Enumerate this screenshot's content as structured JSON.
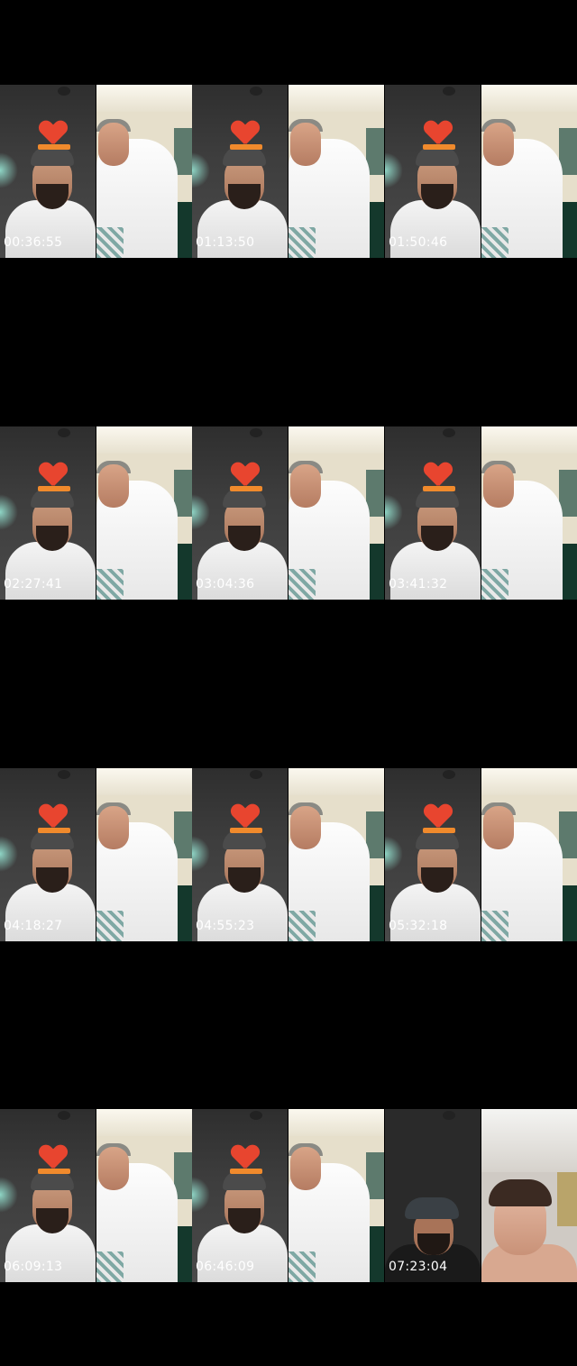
{
  "thumbnails": [
    {
      "timestamp": "00:36:55"
    },
    {
      "timestamp": "01:13:50"
    },
    {
      "timestamp": "01:50:46"
    },
    {
      "timestamp": "02:27:41"
    },
    {
      "timestamp": "03:04:36"
    },
    {
      "timestamp": "03:41:32"
    },
    {
      "timestamp": "04:18:27"
    },
    {
      "timestamp": "04:55:23"
    },
    {
      "timestamp": "05:32:18"
    },
    {
      "timestamp": "06:09:13"
    },
    {
      "timestamp": "06:46:09"
    },
    {
      "timestamp": "07:23:04"
    }
  ],
  "colors": {
    "background": "#000000",
    "timestamp_text": "#ffffff"
  }
}
